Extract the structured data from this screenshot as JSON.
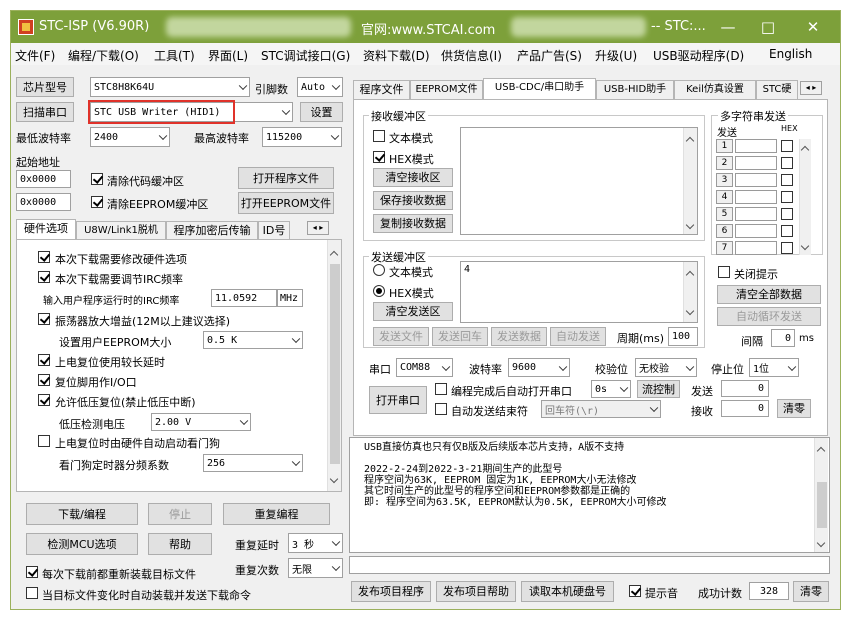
{
  "window": {
    "title": "STC-ISP (V6.90R)",
    "center_text": "官网:www.STCAI.com",
    "right_text": "-- STC:...",
    "min": "—",
    "max": "□",
    "close": "✕"
  },
  "menu": [
    "文件(F)",
    "编程/下载(O)",
    "工具(T)",
    "界面(L)",
    "STC调试接口(G)",
    "资料下载(D)",
    "供货信息(I)",
    "产品广告(S)",
    "升级(U)",
    "USB驱动程序(D)",
    "English"
  ],
  "left": {
    "chip_label": "芯片型号",
    "chip_value": "STC8H8K64U",
    "pins_label": "引脚数",
    "pins_value": "Auto",
    "scan_button": "扫描串口",
    "port_value": "STC USB Writer (HID1)",
    "settings_button": "设置",
    "min_baud_label": "最低波特率",
    "min_baud_value": "2400",
    "max_baud_label": "最高波特率",
    "max_baud_value": "115200",
    "start_addr_label": "起始地址",
    "addr1": "0x0000",
    "clear_code_label": "清除代码缓冲区",
    "open_program_button": "打开程序文件",
    "addr2": "0x0000",
    "clear_eeprom_label": "清除EEPROM缓冲区",
    "open_eeprom_button": "打开EEPROM文件",
    "tabs": [
      "硬件选项",
      "U8W/Link1脱机",
      "程序加密后传输",
      "ID号"
    ],
    "options": [
      {
        "label": "本次下载需要修改硬件选项",
        "checked": true
      },
      {
        "label": "本次下载需要调节IRC频率",
        "checked": true
      },
      {
        "label": "输入用户程序运行时的IRC频率"
      },
      {
        "label": "振荡器放大增益(12M以上建议选择)",
        "checked": true
      },
      {
        "label": "设置用户EEPROM大小"
      },
      {
        "label": "上电复位使用较长延时",
        "checked": true
      },
      {
        "label": "复位脚用作I/O口",
        "checked": true
      },
      {
        "label": "允许低压复位(禁止低压中断)",
        "checked": true
      },
      {
        "label": "低压检测电压"
      },
      {
        "label": "上电复位时由硬件自动启动看门狗",
        "checked": false
      },
      {
        "label": "看门狗定时器分频系数"
      }
    ],
    "irc_value": "11.0592",
    "irc_unit": "MHz",
    "eeprom_value": "0.5 K",
    "lvd_value": "2.00 V",
    "wdt_value": "256",
    "download_button": "下载/编程",
    "stop_button": "停止",
    "reprogram_button": "重复编程",
    "detect_button": "检测MCU选项",
    "help_button": "帮助",
    "repeat_delay_label": "重复延时",
    "repeat_delay_value": "3 秒",
    "repeat_count_label": "重复次数",
    "repeat_count_value": "无限",
    "reload_label": "每次下载前都重新装载目标文件",
    "autoload_label": "当目标文件变化时自动装载并发送下载命令"
  },
  "right": {
    "tabs": [
      "程序文件",
      "EEPROM文件",
      "USB-CDC/串口助手",
      "USB-HID助手",
      "Keil仿真设置",
      "STC硬"
    ],
    "recv_title": "接收缓冲区",
    "text_mode": "文本模式",
    "hex_mode": "HEX模式",
    "clear_recv": "清空接收区",
    "save_recv": "保存接收数据",
    "copy_recv": "复制接收数据",
    "multi_title": "多字符串发送",
    "send_col": "发送",
    "hex_col": "HEX",
    "rows": [
      "1",
      "2",
      "3",
      "4",
      "5",
      "6",
      "7"
    ],
    "close_hint": "关闭提示",
    "clear_all": "清空全部数据",
    "auto_loop": "自动循环发送",
    "interval_label": "间隔",
    "interval_value": "0",
    "interval_unit": "ms",
    "send_title": "发送缓冲区",
    "send_text": "4",
    "clear_send": "清空发送区",
    "send_file": "发送文件",
    "send_enter": "发送回车",
    "send_data": "发送数据",
    "auto_send": "自动发送",
    "period_label": "周期(ms)",
    "period_value": "100",
    "port_label": "串口",
    "port_value": "COM88",
    "baud_label": "波特率",
    "baud_value": "9600",
    "parity_label": "校验位",
    "parity_value": "无校验",
    "stop_label": "停止位",
    "stop_value": "1位",
    "open_port": "打开串口",
    "auto_open_label": "编程完成后自动打开串口",
    "auto_open_value": "0s",
    "flow_ctrl": "流控制",
    "send_count_label": "发送",
    "send_count": "0",
    "end_label": "自动发送结束符",
    "end_value": "回车符(\\r)",
    "recv_count_label": "接收",
    "recv_count": "0",
    "clear_count": "清零"
  },
  "log": [
    "USB直接仿真也只有仅B版及后续版本芯片支持，A版不支持",
    "",
    "2022-2-24到2022-3-21期间生产的此型号",
    "程序空间为63K, EEPROM 固定为1K, EEPROM大小无法修改",
    "其它时间生产的此型号的程序空间和EEPROM参数都是正确的",
    "即: 程序空间为63.5K, EEPROM默认为0.5K, EEPROM大小可修改"
  ],
  "bottom": {
    "publish_program": "发布项目程序",
    "publish_help": "发布项目帮助",
    "read_disk": "读取本机硬盘号",
    "beep_label": "提示音",
    "success_label": "成功计数",
    "success_value": "328",
    "clear": "清零"
  }
}
